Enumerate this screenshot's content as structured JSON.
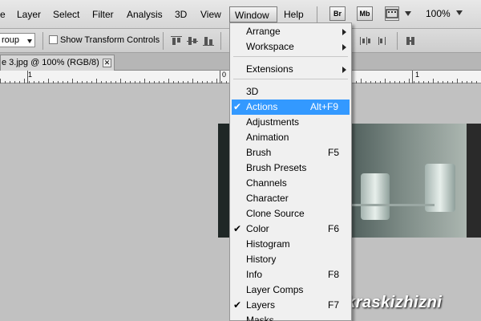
{
  "menubar": {
    "items": [
      "e",
      "Layer",
      "Select",
      "Filter",
      "Analysis",
      "3D",
      "View",
      "Window",
      "Help"
    ],
    "bridge_label": "Br",
    "minibridge_label": "Mb",
    "zoom": "100%"
  },
  "options_bar": {
    "auto_select_value": "roup",
    "show_transform_controls": "Show Transform Controls",
    "show_transform_checked": false
  },
  "document": {
    "tab_title": "e 3.jpg @ 100% (RGB/8)",
    "close_glyph": "✕",
    "ruler_labels": [
      "1",
      "0",
      "1"
    ]
  },
  "window_menu": {
    "items": [
      {
        "label": "Arrange",
        "submenu": true
      },
      {
        "label": "Workspace",
        "submenu": true
      },
      {
        "label": "Extensions",
        "submenu": true
      },
      {
        "label": "3D"
      },
      {
        "label": "Actions",
        "checked": true,
        "shortcut": "Alt+F9",
        "highlighted": true
      },
      {
        "label": "Adjustments"
      },
      {
        "label": "Animation"
      },
      {
        "label": "Brush",
        "shortcut": "F5"
      },
      {
        "label": "Brush Presets"
      },
      {
        "label": "Channels"
      },
      {
        "label": "Character"
      },
      {
        "label": "Clone Source"
      },
      {
        "label": "Color",
        "checked": true,
        "shortcut": "F6"
      },
      {
        "label": "Histogram"
      },
      {
        "label": "History"
      },
      {
        "label": "Info",
        "shortcut": "F8"
      },
      {
        "label": "Layer Comps"
      },
      {
        "label": "Layers",
        "checked": true,
        "shortcut": "F7"
      },
      {
        "label": "Masks"
      }
    ],
    "check_glyph": "✔"
  },
  "watermark": "kraskizhizni",
  "colors": {
    "highlight": "#3399ff",
    "menu_bg": "#f0f0f0",
    "canvas_bg": "#c1c1c1"
  }
}
